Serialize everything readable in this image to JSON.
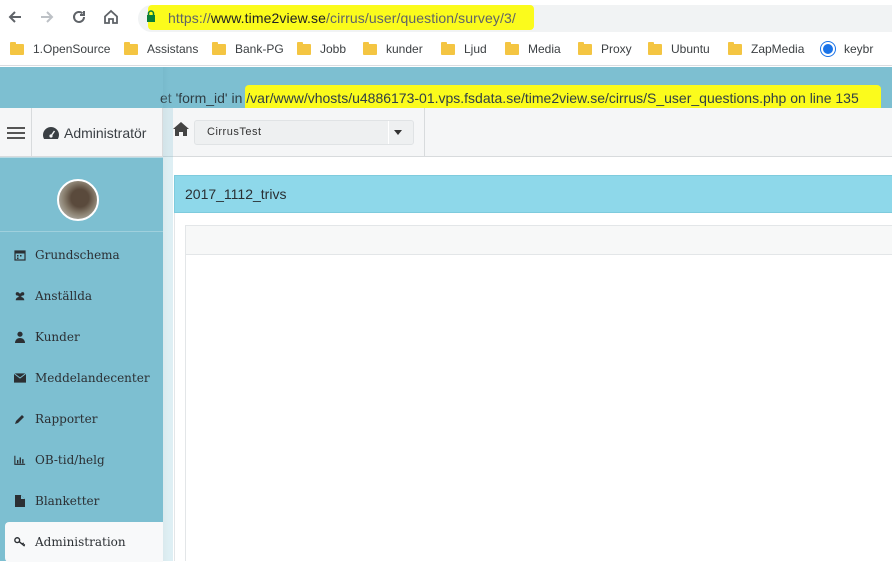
{
  "browser": {
    "url_scheme": "https://",
    "url_host": "www.time2view.se",
    "url_path": "/cirrus/user/question/survey/3/",
    "bookmarks": [
      {
        "label": "1.OpenSource",
        "icon": "folder-icon"
      },
      {
        "label": "Assistans",
        "icon": "folder-icon"
      },
      {
        "label": "Bank-PG",
        "icon": "folder-icon"
      },
      {
        "label": "Jobb",
        "icon": "folder-icon"
      },
      {
        "label": "kunder",
        "icon": "folder-icon"
      },
      {
        "label": "Ljud",
        "icon": "folder-icon"
      },
      {
        "label": "Media",
        "icon": "folder-icon"
      },
      {
        "label": "Proxy",
        "icon": "folder-icon"
      },
      {
        "label": "Ubuntu",
        "icon": "folder-icon"
      },
      {
        "label": "ZapMedia",
        "icon": "folder-icon"
      },
      {
        "label": "keybr",
        "icon": "globe-icon"
      }
    ]
  },
  "error": {
    "prefix": "et 'form_id' in ",
    "path": "/var/www/vhosts/u4886173-01.vps.fsdata.se/time2view.se/cirrus/S_user_questions.php",
    "middle": " on line ",
    "line": "135"
  },
  "header": {
    "brand": "Administratör",
    "company_selected": "CirrusTest"
  },
  "sidebar": {
    "items": [
      {
        "label": "Grundschema",
        "icon": "calendar-icon"
      },
      {
        "label": "Anställda",
        "icon": "users-icon"
      },
      {
        "label": "Kunder",
        "icon": "user-icon"
      },
      {
        "label": "Meddelandecenter",
        "icon": "envelope-icon"
      },
      {
        "label": "Rapporter",
        "icon": "pencil-icon"
      },
      {
        "label": "OB-tid/helg",
        "icon": "bar-chart-icon"
      },
      {
        "label": "Blanketter",
        "icon": "file-icon"
      },
      {
        "label": "Administration",
        "icon": "key-icon"
      }
    ]
  },
  "main": {
    "panel_title": "2017_1112_trivs"
  },
  "colors": {
    "sidebar": "#7dbfd1",
    "panel_header": "#8ed8ea",
    "highlight": "#fbfb1c"
  }
}
